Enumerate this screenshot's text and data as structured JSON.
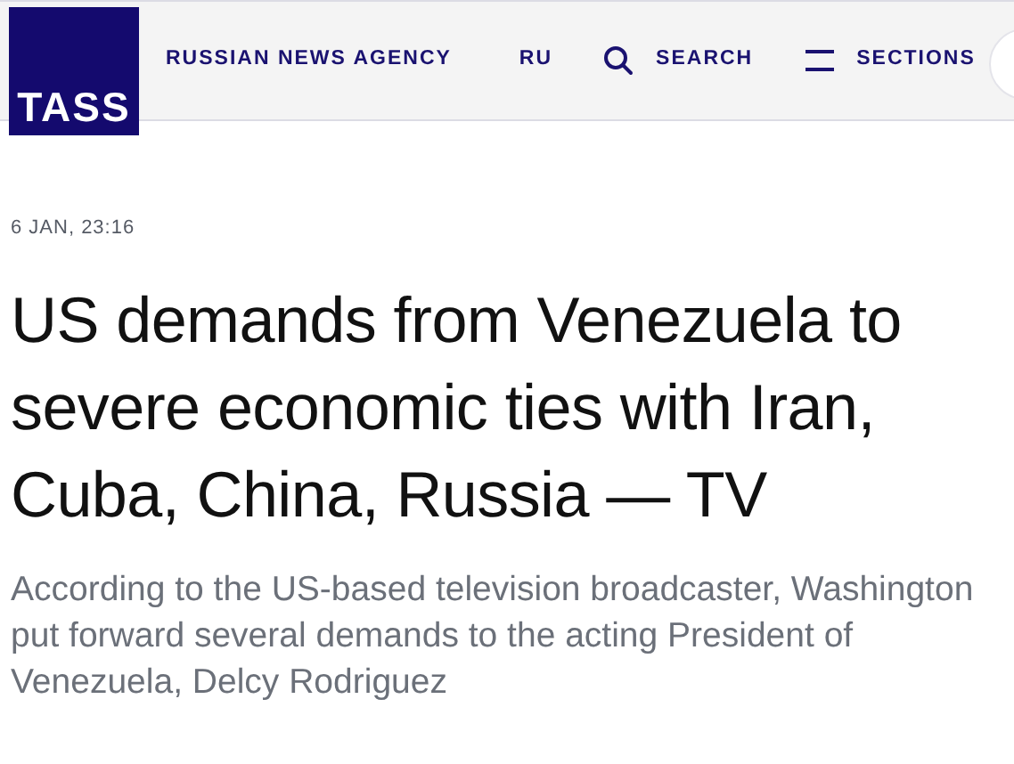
{
  "header": {
    "logo": "TASS",
    "tagline": "RUSSIAN NEWS AGENCY",
    "nav": [
      {
        "kind": "language",
        "label": "RU"
      },
      {
        "kind": "search",
        "label": "SEARCH"
      },
      {
        "kind": "menu",
        "label": "SECTIONS"
      }
    ]
  },
  "article": {
    "date": "6 JAN, 23:16",
    "title": "US demands from Venezuela to severe economic ties with Iran, Cuba, China, Russia — TV",
    "lead": "According to the US-based television broadcaster, Washington put forward several demands to the acting President of Venezuela, Delcy Rodriguez"
  }
}
